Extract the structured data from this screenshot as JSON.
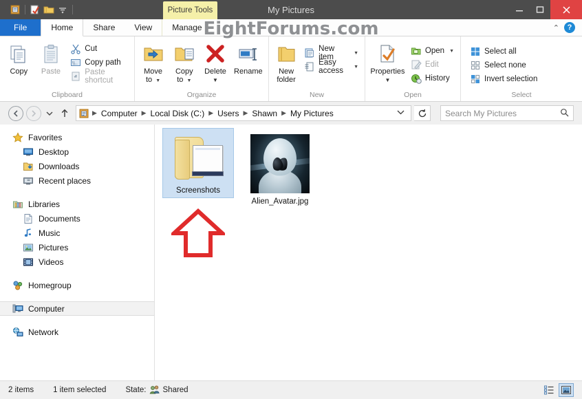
{
  "window": {
    "title": "My Pictures",
    "contextual_tab": "Picture Tools",
    "watermark": "EightForums.com",
    "controls": {
      "minimize": "—",
      "maximize": "❐",
      "close": "✕"
    }
  },
  "quick_access": [
    {
      "name": "properties-icon"
    },
    {
      "name": "new-folder-icon"
    },
    {
      "name": "folder-icon"
    },
    {
      "name": "customize-dropdown-icon"
    }
  ],
  "tabs": [
    {
      "label": "File",
      "kind": "file"
    },
    {
      "label": "Home",
      "kind": "active"
    },
    {
      "label": "Share",
      "kind": "normal"
    },
    {
      "label": "View",
      "kind": "normal"
    },
    {
      "label": "Manage",
      "kind": "contextual"
    }
  ],
  "tab_right": {
    "collapse": "⌃",
    "help": "?"
  },
  "ribbon": {
    "groups": [
      {
        "label": "Clipboard",
        "big": [
          {
            "label": "Copy",
            "icon": "copy-icon",
            "disabled": false
          },
          {
            "label": "Paste",
            "icon": "paste-icon",
            "disabled": true
          }
        ],
        "small": [
          {
            "label": "Cut",
            "icon": "scissors-icon",
            "disabled": false
          },
          {
            "label": "Copy path",
            "icon": "copy-path-icon",
            "disabled": false
          },
          {
            "label": "Paste shortcut",
            "icon": "paste-shortcut-icon",
            "disabled": true
          }
        ]
      },
      {
        "label": "Organize",
        "big": [
          {
            "label": "Move\nto",
            "icon": "move-to-icon",
            "caret": true
          },
          {
            "label": "Copy\nto",
            "icon": "copy-to-icon",
            "caret": true
          },
          {
            "label": "Delete",
            "icon": "delete-icon",
            "caret": true
          },
          {
            "label": "Rename",
            "icon": "rename-icon",
            "caret": false
          }
        ],
        "small": []
      },
      {
        "label": "New",
        "big": [
          {
            "label": "New\nfolder",
            "icon": "new-folder-icon",
            "caret": false
          }
        ],
        "small": [
          {
            "label": "New item",
            "icon": "new-item-icon",
            "caret": true
          },
          {
            "label": "Easy access",
            "icon": "easy-access-icon",
            "caret": true
          }
        ]
      },
      {
        "label": "Open",
        "big": [
          {
            "label": "Properties",
            "icon": "properties-icon",
            "caret": true
          }
        ],
        "small": [
          {
            "label": "Open",
            "icon": "open-icon",
            "caret": true,
            "disabled": false
          },
          {
            "label": "Edit",
            "icon": "edit-icon",
            "caret": false,
            "disabled": true
          },
          {
            "label": "History",
            "icon": "history-icon",
            "caret": false,
            "disabled": false
          }
        ]
      },
      {
        "label": "Select",
        "big": [],
        "small": [
          {
            "label": "Select all",
            "icon": "select-all-icon"
          },
          {
            "label": "Select none",
            "icon": "select-none-icon"
          },
          {
            "label": "Invert selection",
            "icon": "invert-selection-icon"
          }
        ]
      }
    ]
  },
  "address": {
    "back": "←",
    "forward": "→",
    "recent": "▾",
    "up": "↑",
    "crumbs": [
      "Computer",
      "Local Disk (C:)",
      "Users",
      "Shawn",
      "My Pictures"
    ],
    "dropdown": "⌄",
    "refresh": "↻"
  },
  "search": {
    "placeholder": "Search My Pictures",
    "icon": "search-icon"
  },
  "navpane": [
    {
      "label": "Favorites",
      "icon": "star-icon",
      "level": "root"
    },
    {
      "label": "Desktop",
      "icon": "desktop-icon",
      "level": "child"
    },
    {
      "label": "Downloads",
      "icon": "downloads-icon",
      "level": "child"
    },
    {
      "label": "Recent places",
      "icon": "recent-places-icon",
      "level": "child"
    },
    {
      "label": "Libraries",
      "icon": "libraries-icon",
      "level": "root"
    },
    {
      "label": "Documents",
      "icon": "document-icon",
      "level": "child"
    },
    {
      "label": "Music",
      "icon": "music-icon",
      "level": "child"
    },
    {
      "label": "Pictures",
      "icon": "picture-icon",
      "level": "child"
    },
    {
      "label": "Videos",
      "icon": "video-icon",
      "level": "child"
    },
    {
      "label": "Homegroup",
      "icon": "homegroup-icon",
      "level": "root"
    },
    {
      "label": "Computer",
      "icon": "computer-icon",
      "level": "root",
      "selected": true
    },
    {
      "label": "Network",
      "icon": "network-icon",
      "level": "root"
    }
  ],
  "files": [
    {
      "name": "Screenshots",
      "type": "folder",
      "selected": true
    },
    {
      "name": "Alien_Avatar.jpg",
      "type": "image",
      "selected": false
    }
  ],
  "annotation": {
    "type": "red-up-arrow",
    "color": "#e02b2b",
    "points_to": "Screenshots"
  },
  "status": {
    "count": "2 items",
    "selection": "1 item selected",
    "state_label": "State:",
    "state_value": "Shared"
  },
  "view_buttons": [
    {
      "name": "details-view-button",
      "active": false
    },
    {
      "name": "large-icons-view-button",
      "active": true
    }
  ],
  "colors": {
    "titlebar": "#4c4c4c",
    "file_tab": "#1e6fcc",
    "contextual_tab": "#f5f0a9",
    "close_button": "#e04343",
    "selection": "#cde0f3",
    "annotation": "#e02b2b"
  }
}
